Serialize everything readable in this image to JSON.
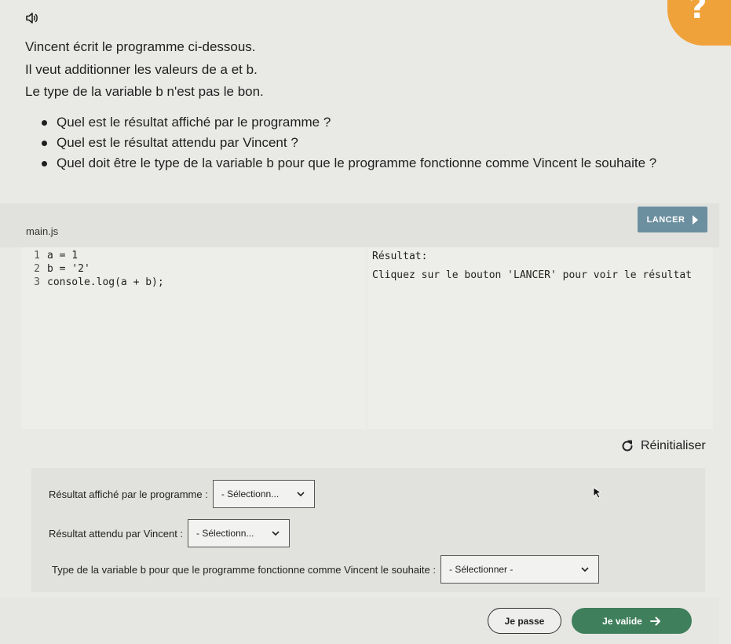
{
  "question": {
    "lines": [
      "Vincent écrit le programme ci-dessous.",
      "Il veut additionner les valeurs de a et b.",
      "Le type de la variable b n'est pas le bon."
    ],
    "bullets": [
      "Quel est le résultat affiché par le programme ?",
      "Quel est le résultat attendu par Vincent ?",
      "Quel doit être le type de la variable b pour que le programme fonctionne comme Vincent le souhaite ?"
    ],
    "help_symbol": "?"
  },
  "editor": {
    "tab_label": "main.js",
    "run_label": "LANCER",
    "code": [
      {
        "num": "1",
        "text": "a = 1"
      },
      {
        "num": "2",
        "text": "b = '2'"
      },
      {
        "num": "3",
        "text": "console.log(a + b);"
      }
    ],
    "result_title": "Résultat:",
    "result_message": "Cliquez sur le bouton 'LANCER' pour voir le résultat"
  },
  "reset_label": "Réinitialiser",
  "answers": {
    "q1_label": "Résultat affiché par le programme :",
    "q1_value": "- Sélectionn...",
    "q2_label": "Résultat attendu par Vincent :",
    "q2_value": "- Sélectionn...",
    "q3_label": "Type de la variable b pour que le programme fonctionne comme Vincent le souhaite :",
    "q3_value": "- Sélectionner -"
  },
  "footer": {
    "pass_label": "Je passe",
    "validate_label": "Je valide"
  },
  "colors": {
    "accent_orange": "#f0a23a",
    "run_button": "#6c8fa0",
    "validate_button": "#3f7f5c"
  }
}
